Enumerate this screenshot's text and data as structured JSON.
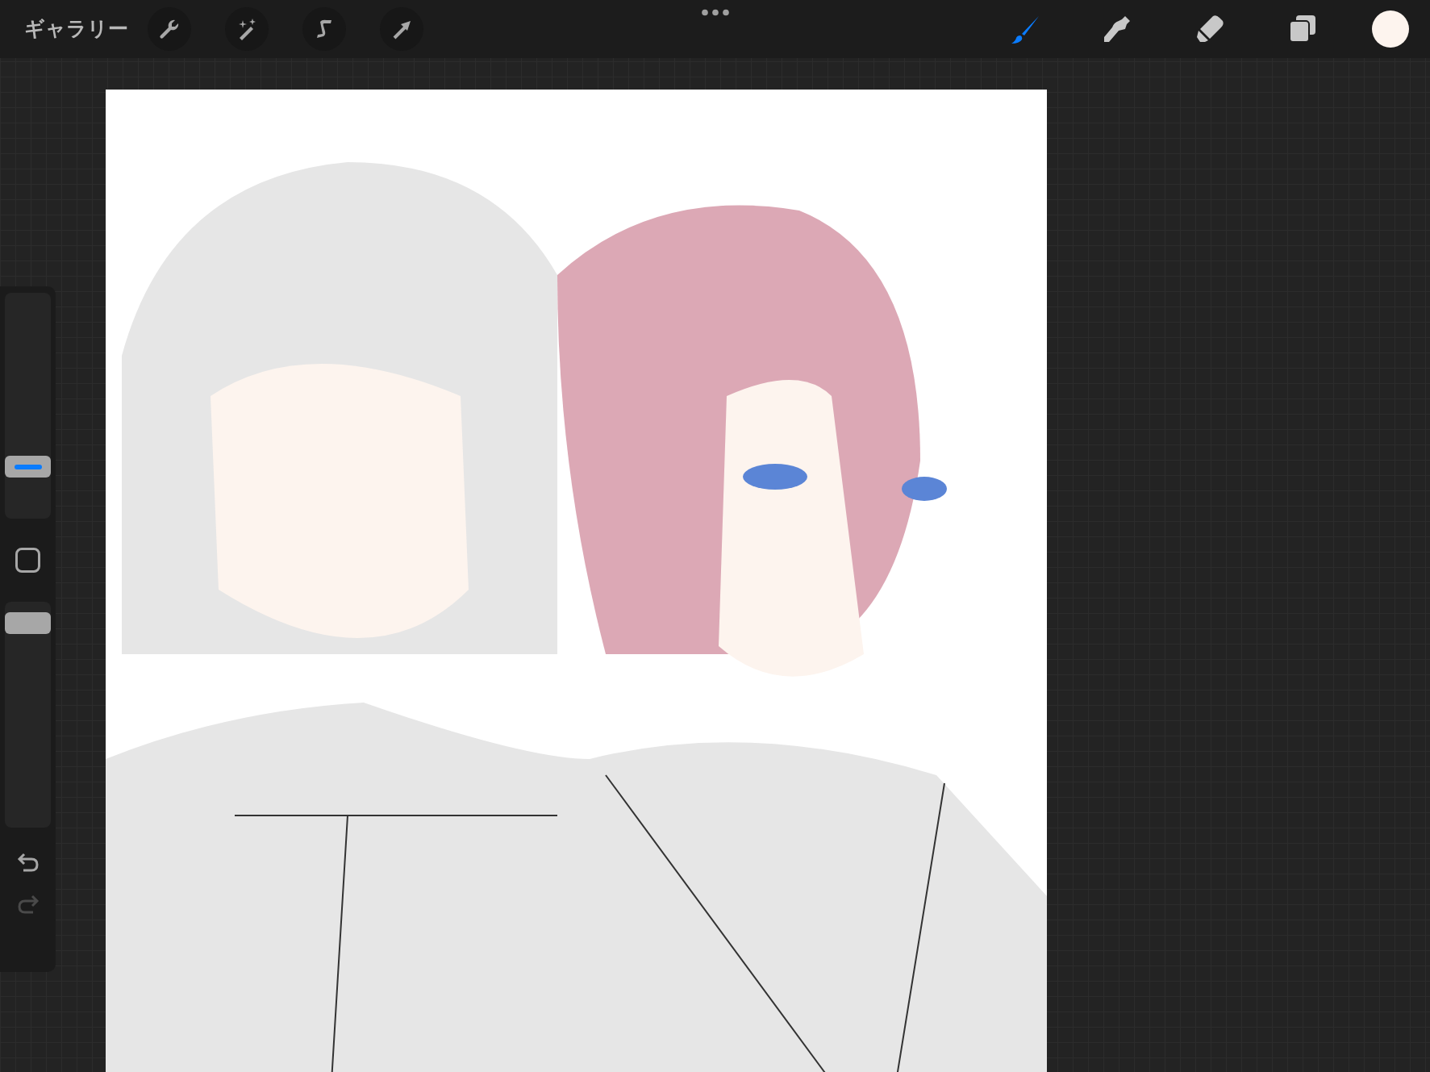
{
  "toolbar": {
    "gallery_label": "ギャラリー",
    "left_tools": [
      {
        "kind": "wrench"
      },
      {
        "kind": "wand"
      },
      {
        "kind": "selection"
      },
      {
        "kind": "transform"
      }
    ],
    "right_tools": [
      {
        "kind": "brush",
        "selected": true
      },
      {
        "kind": "smudge",
        "selected": false
      },
      {
        "kind": "eraser",
        "selected": false
      },
      {
        "kind": "layers",
        "selected": false
      }
    ],
    "color_swatch": {
      "color": "#fdf4ee"
    }
  },
  "sidebar": {
    "size_slider": {
      "level": 0.2
    },
    "opacity_slider": {
      "level": 0.95
    },
    "redo": {
      "disabled": true
    }
  }
}
